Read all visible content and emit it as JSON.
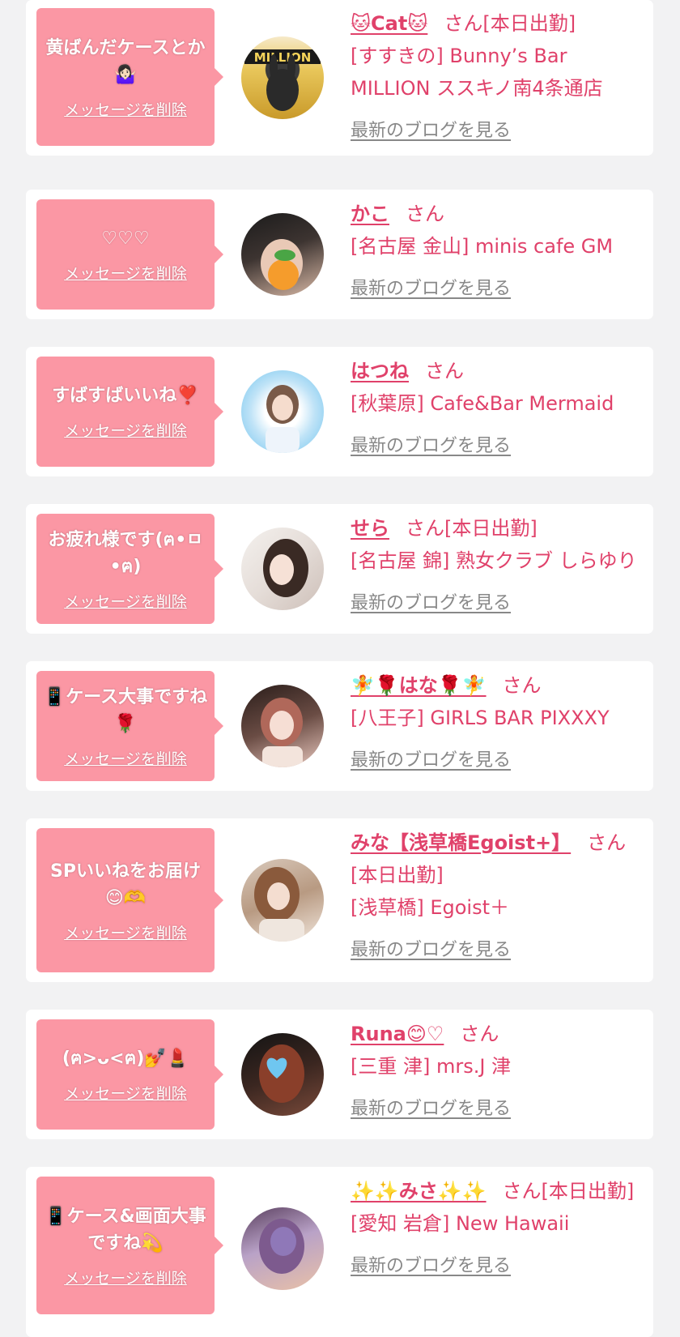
{
  "delete_label": "メッセージを削除",
  "blog_label": "最新のブログを見る",
  "san": "さん",
  "colors": {
    "background": "#f2f2f3",
    "bubble": "#fb97a4",
    "accent": "#e0416a",
    "blog_link": "#888888"
  },
  "items": [
    {
      "message": "黄ばんだケースとか🤷🏻‍♀️",
      "name": "🐱Cat🐱",
      "suffix": "[本日出勤]",
      "store": "[すすきの] Bunny’s Bar MILLION ススキノ南4条通店"
    },
    {
      "message": "♡♡♡",
      "name": "かこ",
      "suffix": "",
      "store": "[名古屋 金山] minis cafe GM"
    },
    {
      "message": "すばすばいいね❣️",
      "name": "はつね",
      "suffix": "",
      "store": "[秋葉原] Cafe&Bar Mermaid"
    },
    {
      "message": "お疲れ様です(ฅ•ㅁ•ฅ)",
      "name": "せら",
      "suffix": "[本日出勤]",
      "store": "[名古屋 錦] 熟女クラブ しらゆり"
    },
    {
      "message": "📱ケース大事ですね🌹",
      "name": "🧚🌹はな🌹🧚",
      "suffix": "",
      "store": "[八王子] GIRLS BAR PIXXXY"
    },
    {
      "message": "SPいいねをお届け😊🫶",
      "name": "みな【浅草橋Egoist+】",
      "suffix": "[本日出勤]",
      "store": "[浅草橋] Egoist＋"
    },
    {
      "message": "(ฅ>ᴗ<ฅ)💅💄",
      "name": "Runa😊♡",
      "suffix": "",
      "store": "[三重 津] mrs.J 津"
    },
    {
      "message": "📱ケース&画面大事ですね💫",
      "name": "✨✨みさ✨✨",
      "suffix": "[本日出勤]",
      "store": "[愛知 岩倉] New Hawaii"
    }
  ]
}
